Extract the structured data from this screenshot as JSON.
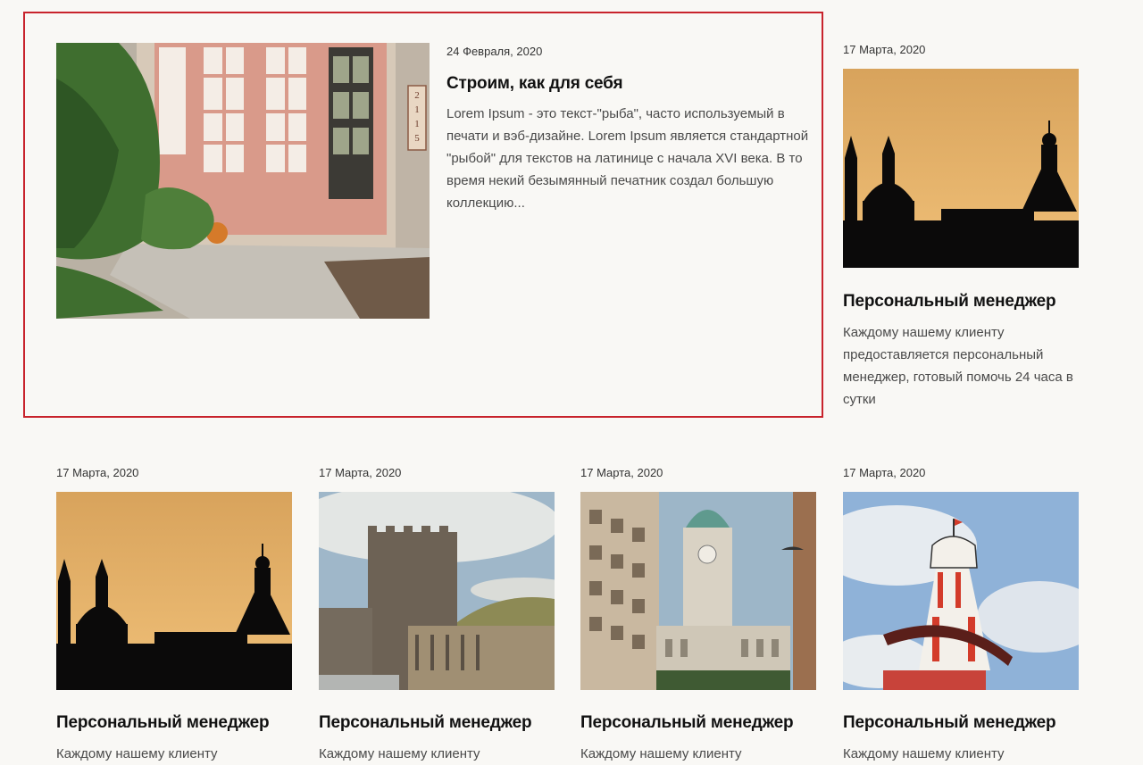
{
  "featured": {
    "date": "24 Февраля, 2020",
    "title": "Строим, как для себя",
    "description": "Lorem Ipsum - это текст-\"рыба\", часто используемый в печати и вэб-дизайне. Lorem Ipsum является стандартной \"рыбой\" для текстов на латинице с начала XVI века. В то время некий безымянный печатник создал большую коллекцию...",
    "house_number": "2115"
  },
  "side": {
    "date": "17 Марта, 2020",
    "title": "Персональный менеджер",
    "description": "Каждому нашему клиенту предоставляется персональный менеджер, готовый помочь 24 часа в сутки"
  },
  "grid": [
    {
      "date": "17 Марта, 2020",
      "title": "Персональный менеджер",
      "description": "Каждому нашему клиенту"
    },
    {
      "date": "17 Марта, 2020",
      "title": "Персональный менеджер",
      "description": "Каждому нашему клиенту"
    },
    {
      "date": "17 Марта, 2020",
      "title": "Персональный менеджер",
      "description": "Каждому нашему клиенту"
    },
    {
      "date": "17 Марта, 2020",
      "title": "Персональный менеджер",
      "description": "Каждому нашему клиенту"
    }
  ],
  "colors": {
    "accent_border": "#c8232c",
    "background": "#f9f8f5"
  }
}
